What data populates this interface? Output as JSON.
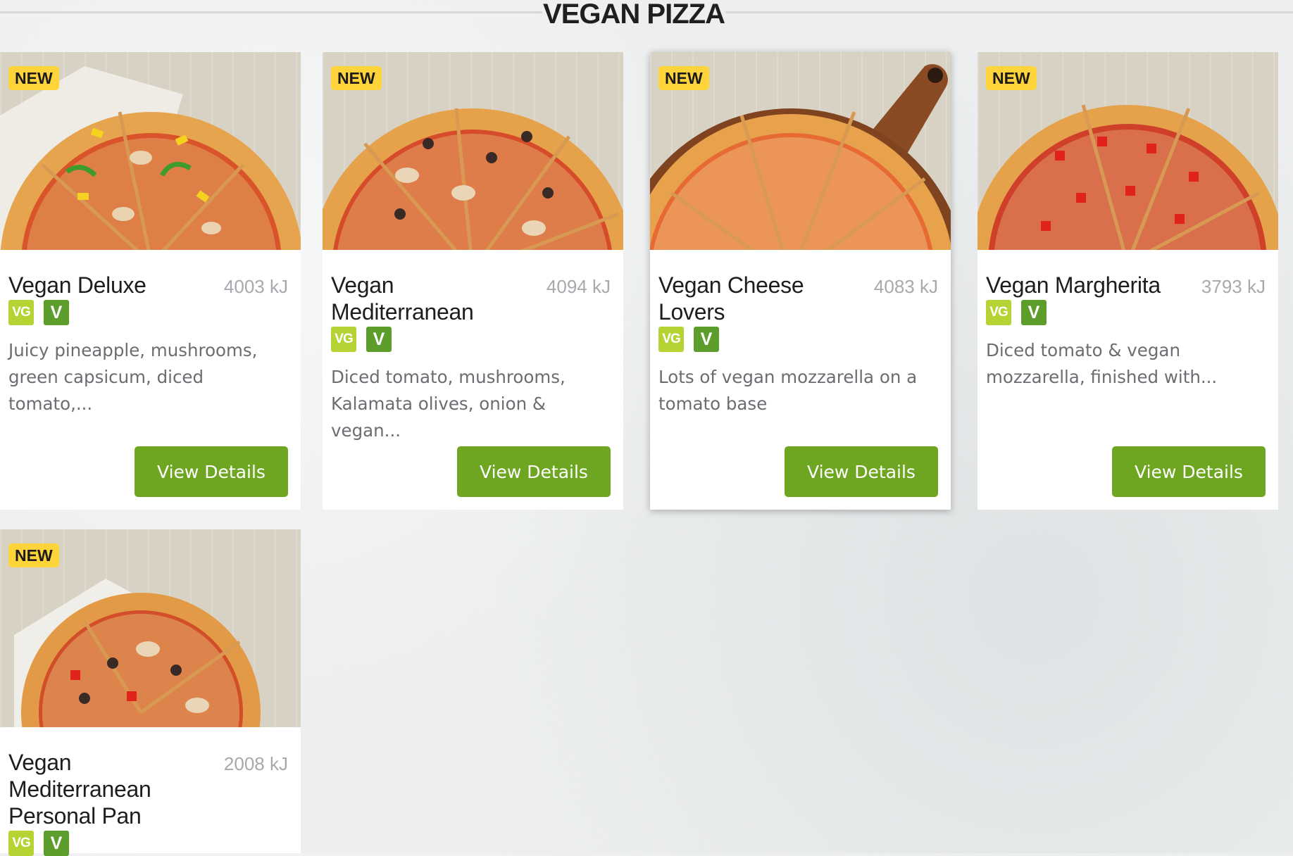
{
  "section": {
    "title": "VEGAN PIZZA"
  },
  "products": [
    {
      "badge": "NEW",
      "name": "Vegan Deluxe",
      "energy": "4003 kJ",
      "tags": [
        "VG",
        "V"
      ],
      "description": "Juicy pineapple, mushrooms, green capsicum, diced tomato,...",
      "button": "View Details"
    },
    {
      "badge": "NEW",
      "name": "Vegan Mediterranean",
      "energy": "4094 kJ",
      "tags": [
        "VG",
        "V"
      ],
      "description": "Diced tomato, mushrooms, Kalamata olives, onion & vegan...",
      "button": "View Details"
    },
    {
      "badge": "NEW",
      "name": "Vegan Cheese Lovers",
      "energy": "4083 kJ",
      "tags": [
        "VG",
        "V"
      ],
      "description": "Lots of vegan mozzarella on a tomato base",
      "button": "View Details"
    },
    {
      "badge": "NEW",
      "name": "Vegan Margherita",
      "energy": "3793 kJ",
      "tags": [
        "VG",
        "V"
      ],
      "description": "Diced tomato & vegan mozzarella, finished with...",
      "button": "View Details"
    },
    {
      "badge": "NEW",
      "name": "Vegan Mediterranean Personal Pan",
      "energy": "2008 kJ",
      "tags": [
        "VG",
        "V"
      ]
    }
  ],
  "colors": {
    "badge_new": "#ffd43a",
    "button": "#6ea622",
    "tag_vg": "#b6d334",
    "tag_v": "#5c9d2c"
  },
  "icons": [
    "pizza-photo",
    "vegan-tag-icon",
    "vegetarian-tag-icon"
  ]
}
